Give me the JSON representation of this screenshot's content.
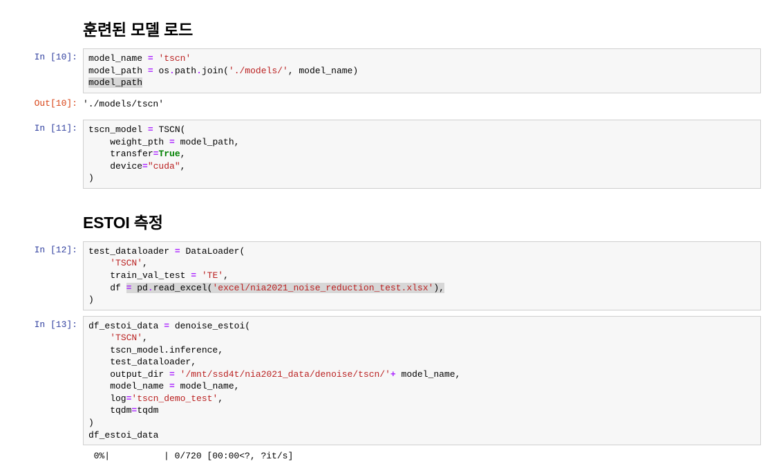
{
  "prompts": {
    "in10": "In [10]:",
    "out10": "Out[10]:",
    "in11": "In [11]:",
    "in12": "In [12]:",
    "in13": "In [13]:"
  },
  "heading1": "훈련된 모델 로드",
  "heading2": "ESTOI 측정",
  "c10": {
    "l1a": "model_name ",
    "l1op": "=",
    "l1s": " 'tscn'",
    "l2a": "model_path ",
    "l2op": "=",
    "l2b": " os",
    "l2dot": ".",
    "l2c": "path",
    "l2dot2": ".",
    "l2d": "join(",
    "l2s": "'./models/'",
    "l2e": ", model_name)",
    "l3sel": "model_path"
  },
  "out10_text": "'./models/tscn'",
  "c11": {
    "l1": "tscn_model ",
    "l1op": "=",
    "l1b": " TSCN(",
    "l2a": "    weight_pth ",
    "l2op": "=",
    "l2b": " model_path,",
    "l3a": "    transfer",
    "l3op": "=",
    "l3kw": "True",
    "l3c": ",",
    "l4a": "    device",
    "l4op": "=",
    "l4s": "\"cuda\"",
    "l4c": ",",
    "l5": ")"
  },
  "c12": {
    "l1a": "test_dataloader ",
    "l1op": "=",
    "l1b": " DataLoader(",
    "l2a": "    ",
    "l2s": "'TSCN'",
    "l2c": ",",
    "l3a": "    train_val_test ",
    "l3op": "=",
    "l3s": " 'TE'",
    "l3c": ",",
    "l4a": "    df ",
    "l4op": "= ",
    "l4b": "pd",
    "l4dot": ".",
    "l4c": "read_excel(",
    "l4s": "'excel/nia2021_noise_reduction_test.xlsx'",
    "l4d": "),",
    "l5": ")"
  },
  "c13": {
    "l1a": "df_estoi_data ",
    "l1op": "=",
    "l1b": " denoise_estoi(",
    "l2a": "    ",
    "l2s": "'TSCN'",
    "l2c": ",",
    "l3": "    tscn_model.inference,",
    "l4": "    test_dataloader,",
    "l5a": "    output_dir ",
    "l5op": "=",
    "l5s": " '/mnt/ssd4t/nia2021_data/denoise/tscn/'",
    "l5op2": "+",
    "l5b": " model_name,",
    "l6a": "    model_name ",
    "l6op": "=",
    "l6b": " model_name,",
    "l7a": "    log",
    "l7op": "=",
    "l7s": "'tscn_demo_test'",
    "l7c": ",",
    "l8a": "    tqdm",
    "l8op": "=",
    "l8b": "tqdm",
    "l9": ")",
    "l10": "df_estoi_data"
  },
  "progress": "  0%|          | 0/720 [00:00<?, ?it/s]"
}
